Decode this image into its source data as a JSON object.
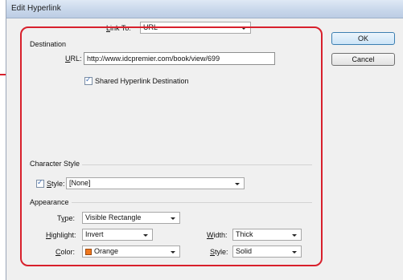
{
  "window": {
    "title": "Edit Hyperlink"
  },
  "link_to": {
    "label": "Link To:",
    "value": "URL"
  },
  "destination": {
    "heading": "Destination",
    "url_label": "URL:",
    "url_value": "http://www.idcpremier.com/book/view/699",
    "shared_label": "Shared Hyperlink Destination",
    "shared_checked": true
  },
  "character_style": {
    "heading": "Character Style",
    "style_label": "Style:",
    "style_value": "[None]",
    "style_checked": true
  },
  "appearance": {
    "heading": "Appearance",
    "type_label": "Type:",
    "type_value": "Visible Rectangle",
    "highlight_label": "Highlight:",
    "highlight_value": "Invert",
    "width_label": "Width:",
    "width_value": "Thick",
    "color_label": "Color:",
    "color_value": "Orange",
    "color_hex": "#f0781e",
    "style_label": "Style:",
    "style_value": "Solid"
  },
  "buttons": {
    "ok": "OK",
    "cancel": "Cancel"
  },
  "colors": {
    "callout": "#d8202c"
  }
}
